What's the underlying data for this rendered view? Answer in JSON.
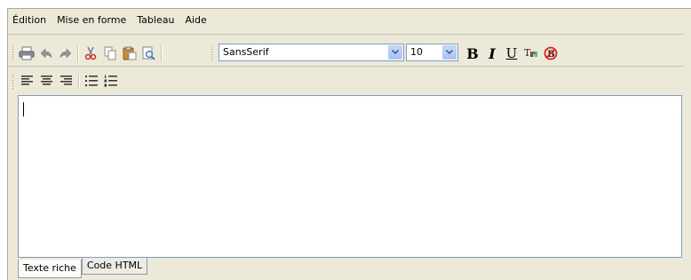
{
  "menubar": {
    "items": [
      {
        "label": "Édition"
      },
      {
        "label": "Mise en forme"
      },
      {
        "label": "Tableau"
      },
      {
        "label": "Aide"
      }
    ]
  },
  "toolbar": {
    "buttons": [
      "printer-icon",
      "undo-icon",
      "redo-icon",
      "cut-icon",
      "copy-icon",
      "paste-icon",
      "find-icon"
    ],
    "font_family": {
      "value": "SansSerif"
    },
    "font_size": {
      "value": "10"
    },
    "format_buttons": [
      {
        "name": "bold-button",
        "label": "B"
      },
      {
        "name": "italic-button",
        "label": "I"
      },
      {
        "name": "underline-button",
        "label": "U"
      },
      {
        "name": "text-color-button",
        "icon": "text-color-icon"
      },
      {
        "name": "clear-format-button",
        "icon": "no-format-icon"
      }
    ]
  },
  "toolbar2": {
    "buttons": [
      "align-left-icon",
      "align-center-icon",
      "align-right-icon",
      "bullet-list-icon",
      "numbered-list-icon"
    ]
  },
  "tabs": [
    {
      "label": "Texte riche",
      "active": true
    },
    {
      "label": "Code HTML",
      "active": false
    }
  ],
  "colors": {
    "frame_bg": "#ece9d8",
    "border_blue": "#7f9db9",
    "no_format_red": "#e02020"
  }
}
